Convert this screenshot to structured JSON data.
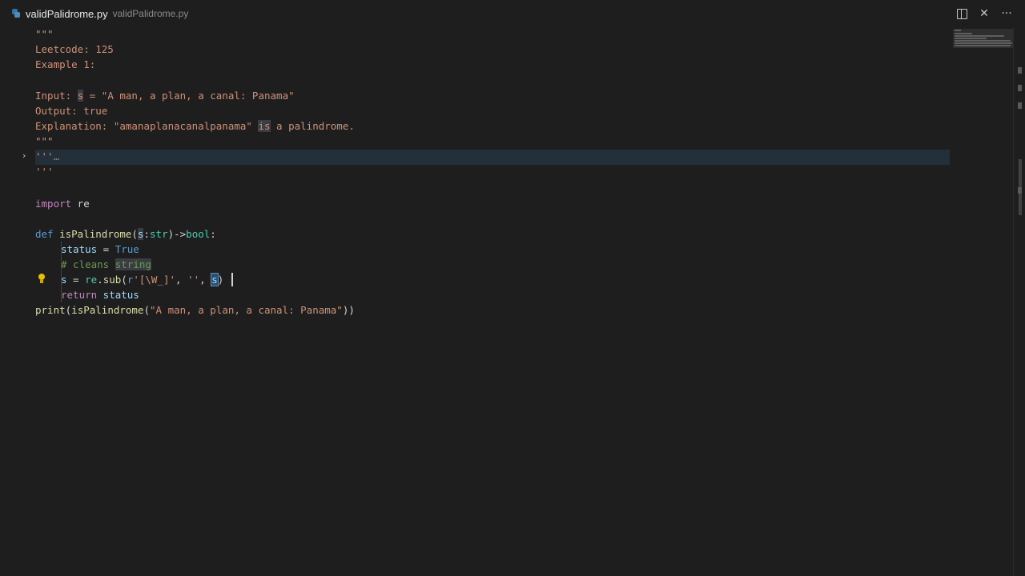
{
  "tab": {
    "title": "validPalidrome.py",
    "description": "validPalidrome.py"
  },
  "actions": {
    "split_icon": "split-editor-icon",
    "close_glyph": "✕",
    "more_glyph": "···"
  },
  "code": {
    "l1": "\"\"\"",
    "l2": "Leetcode: 125",
    "l3": "Example 1:",
    "l5_a": "Input: ",
    "l5_b": "s",
    "l5_c": " = \"A man, a plan, a canal: Panama\"",
    "l6": "Output: true",
    "l7_a": "Explanation: \"amanaplanacanalpanama\" ",
    "l7_b": "is",
    "l7_c": " a palindrome.",
    "l8": "\"\"\"",
    "l9_a": "'''",
    "l9_b": "…",
    "l10": "'''",
    "l12_kw": "import",
    "l12_mod": " re",
    "l14_def": "def",
    "l14_fn": "isPalindrome",
    "l14_p1": "(",
    "l14_param": "s",
    "l14_p2": ":",
    "l14_typ": "str",
    "l14_p3": ")->",
    "l14_ret": "bool",
    "l14_p4": ":",
    "l15_var": "status",
    "l15_eq": " = ",
    "l15_val": "True",
    "l16_a": "# cleans ",
    "l16_b": "string",
    "l17_var": "s",
    "l17_eq": " = ",
    "l17_mod": "re",
    "l17_dot": ".",
    "l17_fn": "sub",
    "l17_p1": "(",
    "l17_r": "r",
    "l17_pat": "'[\\W_]'",
    "l17_c1": ", ",
    "l17_empty": "''",
    "l17_c2": ", ",
    "l17_arg": "s",
    "l17_p2": ")",
    "l18_kw": "return",
    "l18_var": " status",
    "l19_fn": "print",
    "l19_p1": "(",
    "l19_call": "isPalindrome",
    "l19_p2": "(",
    "l19_str": "\"A man, a plan, a canal: Panama\"",
    "l19_p3": "))"
  }
}
